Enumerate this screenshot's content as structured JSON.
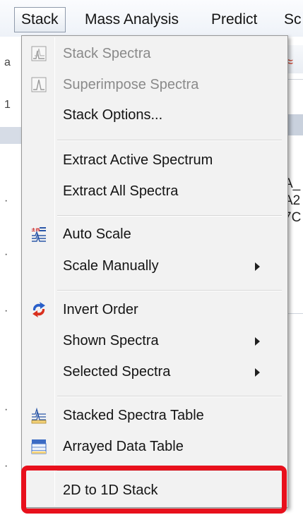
{
  "menubar": {
    "items": [
      {
        "label": "Stack"
      },
      {
        "label": "Mass Analysis"
      },
      {
        "label": "Predict"
      },
      {
        "label": "Sc"
      }
    ]
  },
  "background": {
    "right_text": [
      "A_",
      "A2",
      "7C"
    ]
  },
  "menu": {
    "items": [
      {
        "label": "Stack Spectra",
        "icon": "stack-spectra-icon",
        "disabled": true
      },
      {
        "label": "Superimpose Spectra",
        "icon": "superimpose-spectra-icon",
        "disabled": true
      },
      {
        "label": "Stack Options..."
      },
      {
        "label": "Extract Active Spectrum"
      },
      {
        "label": "Extract All Spectra"
      },
      {
        "label": "Auto Scale",
        "icon": "auto-scale-icon"
      },
      {
        "label": "Scale Manually",
        "submenu": true
      },
      {
        "label": "Invert Order",
        "icon": "invert-order-icon"
      },
      {
        "label": "Shown Spectra",
        "submenu": true
      },
      {
        "label": "Selected Spectra",
        "submenu": true
      },
      {
        "label": "Stacked Spectra Table",
        "icon": "stacked-spectra-table-icon"
      },
      {
        "label": "Arrayed Data Table",
        "icon": "arrayed-data-table-icon"
      },
      {
        "label": "2D to 1D Stack",
        "highlighted": true
      }
    ]
  },
  "colors": {
    "highlight": "#e8101c",
    "menu_background": "#f2f2f2",
    "disabled_text": "#8a8a8a"
  }
}
